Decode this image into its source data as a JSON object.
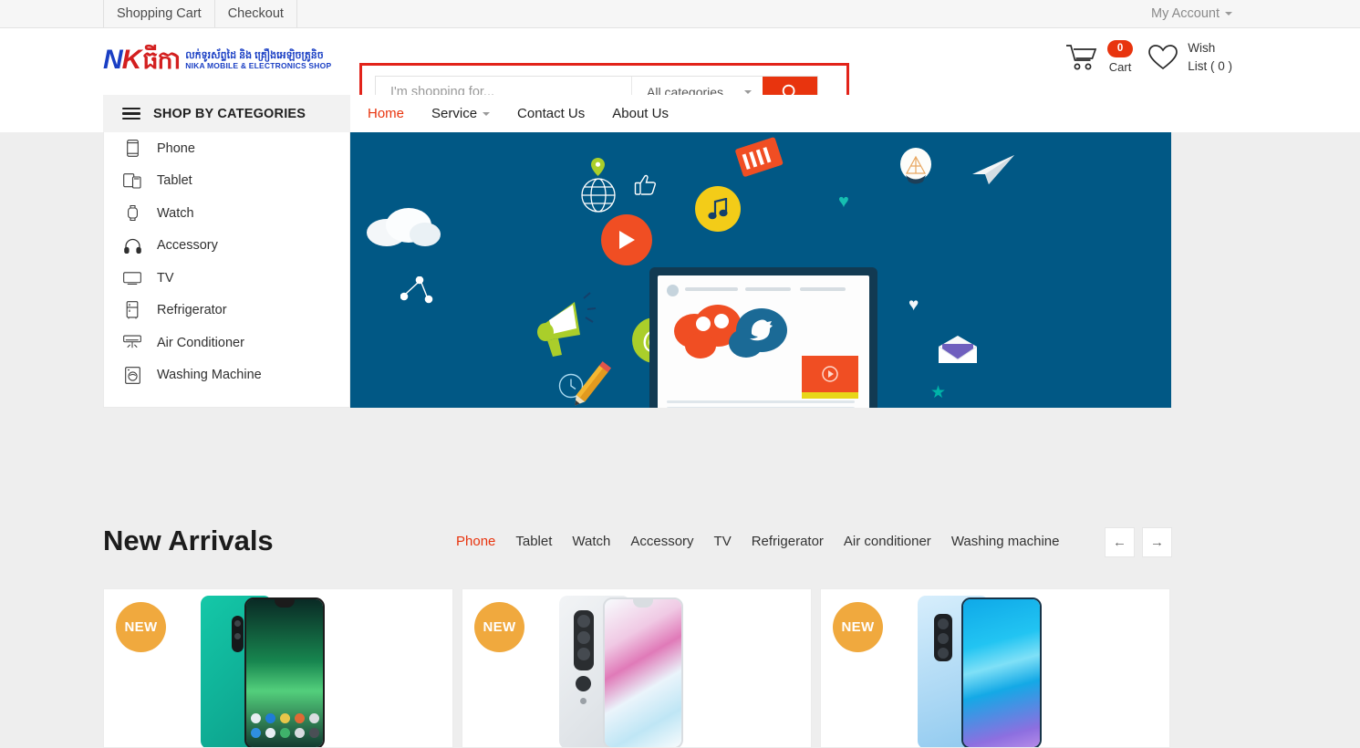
{
  "topbar": {
    "links": [
      {
        "label": "Shopping Cart",
        "name": "topbar-shopping-cart"
      },
      {
        "label": "Checkout",
        "name": "topbar-checkout"
      }
    ],
    "account_label": "My Account"
  },
  "logo": {
    "nk_n": "N",
    "nk_k": "K",
    "khmer_name": "ធីកា",
    "khmer_tagline": "លក់ទូរស័ព្ទដៃ និង គ្រឿងអេឡិចត្រូនិច",
    "english_tagline": "NIKA MOBILE & ELECTRONICS SHOP"
  },
  "search": {
    "placeholder": "I'm shopping for...",
    "value": "",
    "category_selected": "All categories",
    "button_icon": "search-icon",
    "highlight_color": "#e2231a",
    "button_color": "#e8340e"
  },
  "header_actions": {
    "cart_icon": "shopping-cart-icon",
    "cart_count": "0",
    "cart_label": "Cart",
    "wishlist_icon": "heart-icon",
    "wishlist_line1": "Wish",
    "wishlist_line2": "List ( 0 )"
  },
  "nav": {
    "shop_by_categories": "SHOP BY CATEGORIES",
    "menu_icon": "hamburger-icon",
    "links": [
      {
        "label": "Home",
        "active": true,
        "caret": false
      },
      {
        "label": "Service",
        "active": false,
        "caret": true
      },
      {
        "label": "Contact Us",
        "active": false,
        "caret": false
      },
      {
        "label": "About Us",
        "active": false,
        "caret": false
      }
    ]
  },
  "sidebar": {
    "items": [
      {
        "label": "Phone",
        "icon": "phone-icon"
      },
      {
        "label": "Tablet",
        "icon": "tablet-icon"
      },
      {
        "label": "Watch",
        "icon": "watch-icon"
      },
      {
        "label": "Accessory",
        "icon": "headphones-icon"
      },
      {
        "label": "TV",
        "icon": "tv-icon"
      },
      {
        "label": "Refrigerator",
        "icon": "refrigerator-icon"
      },
      {
        "label": "Air Conditioner",
        "icon": "air-conditioner-icon"
      },
      {
        "label": "Washing Machine",
        "icon": "washing-machine-icon"
      }
    ]
  },
  "banner": {
    "background_color": "#015885",
    "icons": [
      "location-pin-icon",
      "globe-icon",
      "thumbs-up-icon",
      "play-button-icon",
      "clock-icon",
      "music-note-icon",
      "megaphone-icon",
      "at-sign-icon",
      "pencil-icon",
      "ticket-icon",
      "share-network-icon",
      "paper-plane-icon",
      "lightbulb-icon",
      "cloud-icon",
      "star-icon",
      "heart-icon",
      "envelope-icon",
      "twitter-bird-icon",
      "chat-bubble-icon",
      "video-player-icon",
      "tablet-device-icon"
    ]
  },
  "new_arrivals": {
    "title": "New Arrivals",
    "tabs": [
      {
        "label": "Phone",
        "active": true
      },
      {
        "label": "Tablet",
        "active": false
      },
      {
        "label": "Watch",
        "active": false
      },
      {
        "label": "Accessory",
        "active": false
      },
      {
        "label": "TV",
        "active": false
      },
      {
        "label": "Refrigerator",
        "active": false
      },
      {
        "label": "Air conditioner",
        "active": false
      },
      {
        "label": "Washing machine",
        "active": false
      }
    ],
    "prev_arrow": "←",
    "next_arrow": "→",
    "products": [
      {
        "badge": "NEW",
        "image_alt": "green-phone",
        "back_color": "#1fb7a0",
        "screen_color": "#1d9f7d"
      },
      {
        "badge": "NEW",
        "image_alt": "white-pink-phone",
        "back_color": "#e4e7ea",
        "screen_color": "#efd5e6"
      },
      {
        "badge": "NEW",
        "image_alt": "blue-phone",
        "back_color": "#bcdcf4",
        "screen_color": "#12b3ef"
      }
    ],
    "badge_color": "#f0a93e"
  }
}
